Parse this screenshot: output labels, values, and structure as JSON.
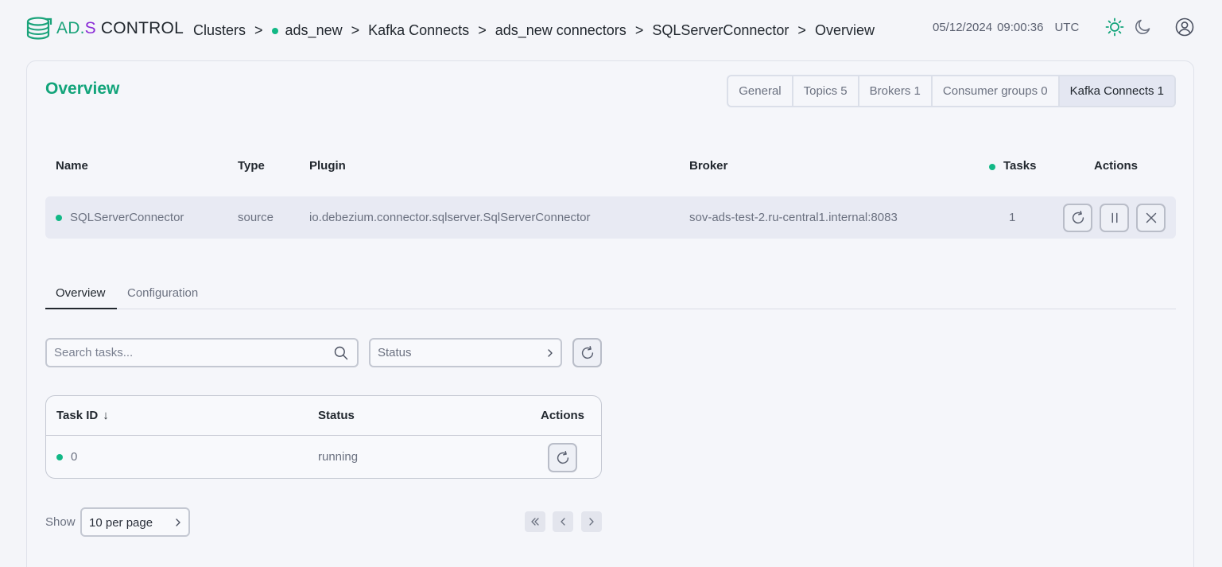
{
  "header": {
    "logo": {
      "brand_prefix": "AD",
      "brand_dot": ".",
      "brand_suffix": "S",
      "product": " CONTROL"
    },
    "breadcrumb": [
      {
        "label": "Clusters",
        "has_dot": false
      },
      {
        "label": "ads_new",
        "has_dot": true
      },
      {
        "label": "Kafka Connects",
        "has_dot": false
      },
      {
        "label": "ads_new connectors",
        "has_dot": false
      },
      {
        "label": "SQLServerConnector",
        "has_dot": false
      },
      {
        "label": "Overview",
        "has_dot": false
      }
    ],
    "breadcrumb_separator": ">",
    "date": "05/12/2024",
    "time": "09:00:36",
    "timezone": "UTC",
    "icons": {
      "light_theme": "sun-icon",
      "dark_theme": "moon-icon",
      "user": "user-avatar-icon"
    }
  },
  "overview": {
    "title": "Overview",
    "tabs": [
      {
        "label": "General",
        "active": false
      },
      {
        "label": "Topics 5",
        "active": false
      },
      {
        "label": "Brokers 1",
        "active": false
      },
      {
        "label": "Consumer groups 0",
        "active": false
      },
      {
        "label": "Kafka Connects 1",
        "active": true
      }
    ]
  },
  "connector_table": {
    "columns": {
      "name": "Name",
      "type": "Type",
      "plugin": "Plugin",
      "broker": "Broker",
      "tasks": "Tasks",
      "actions": "Actions"
    },
    "row": {
      "name": "SQLServerConnector",
      "type": "source",
      "plugin": "io.debezium.connector.sqlserver.SqlServerConnector",
      "broker": "sov-ads-test-2.ru-central1.internal:8083",
      "tasks": "1",
      "actions": [
        "restart-icon",
        "pause-icon",
        "close-icon"
      ]
    }
  },
  "sub_tabs": [
    {
      "label": "Overview",
      "active": true
    },
    {
      "label": "Configuration",
      "active": false
    }
  ],
  "filters": {
    "search_placeholder": "Search tasks...",
    "search_value": "",
    "status_label": "Status"
  },
  "tasks_table": {
    "columns": {
      "task_id": "Task ID",
      "sort_indicator": "↓",
      "status": "Status",
      "actions": "Actions"
    },
    "rows": [
      {
        "task_id": "0",
        "status": "running"
      }
    ]
  },
  "pagination": {
    "show_label": "Show",
    "per_page_value": "10 per page"
  },
  "colors": {
    "accent": "#12a47a",
    "status_running": "#12b886",
    "brand_purple": "#8a2bd6"
  }
}
